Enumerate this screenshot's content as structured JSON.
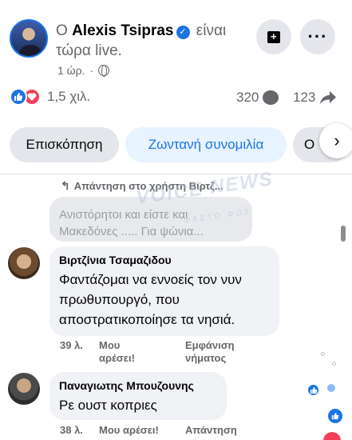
{
  "post": {
    "prefix": "Ο",
    "author": "Alexis Tsipras",
    "suffix": "είναι τώρα live.",
    "time": "1 ώρ.",
    "separator": "·"
  },
  "stats": {
    "reactions": "1,5 χιλ.",
    "comments": "320",
    "shares": "123"
  },
  "tabs": [
    {
      "label": "Επισκόπηση",
      "active": false
    },
    {
      "label": "Ζωντανή συνομιλία",
      "active": true
    },
    {
      "label": "Ο",
      "active": false
    }
  ],
  "comments": {
    "reply_to": "Απάντηση στο χρήστη Βιρτζ...",
    "faded_text": "Ανιστόρητοι και είστε και Μακεδόνες ..... Για ψώνια...",
    "watermark": "VOICE NEWS",
    "watermark_sub": "ΦΑΣΤΟ ΦΩΣ",
    "items": [
      {
        "author": "Βιρτζίνια Τσαμαζιδου",
        "text": "Φαντάζομαι να εννοείς τον νυν πρωθυπουργό, που αποστρατικοποίησε τα νησιά.",
        "time": "39 λ.",
        "like": "Μου αρέσει!",
        "extra": "Εμφάνιση νήματος"
      },
      {
        "author": "Παναγιωτης Μπουζουνης",
        "text": "Ρε ουστ κοπριες",
        "time": "38 λ.",
        "like": "Μου αρέσει!",
        "extra": "Απάντηση"
      }
    ]
  },
  "colors": {
    "accent": "#1b74e4",
    "love": "#f33e58",
    "secondary_text": "#65676b",
    "bubble": "#f0f2f5"
  }
}
